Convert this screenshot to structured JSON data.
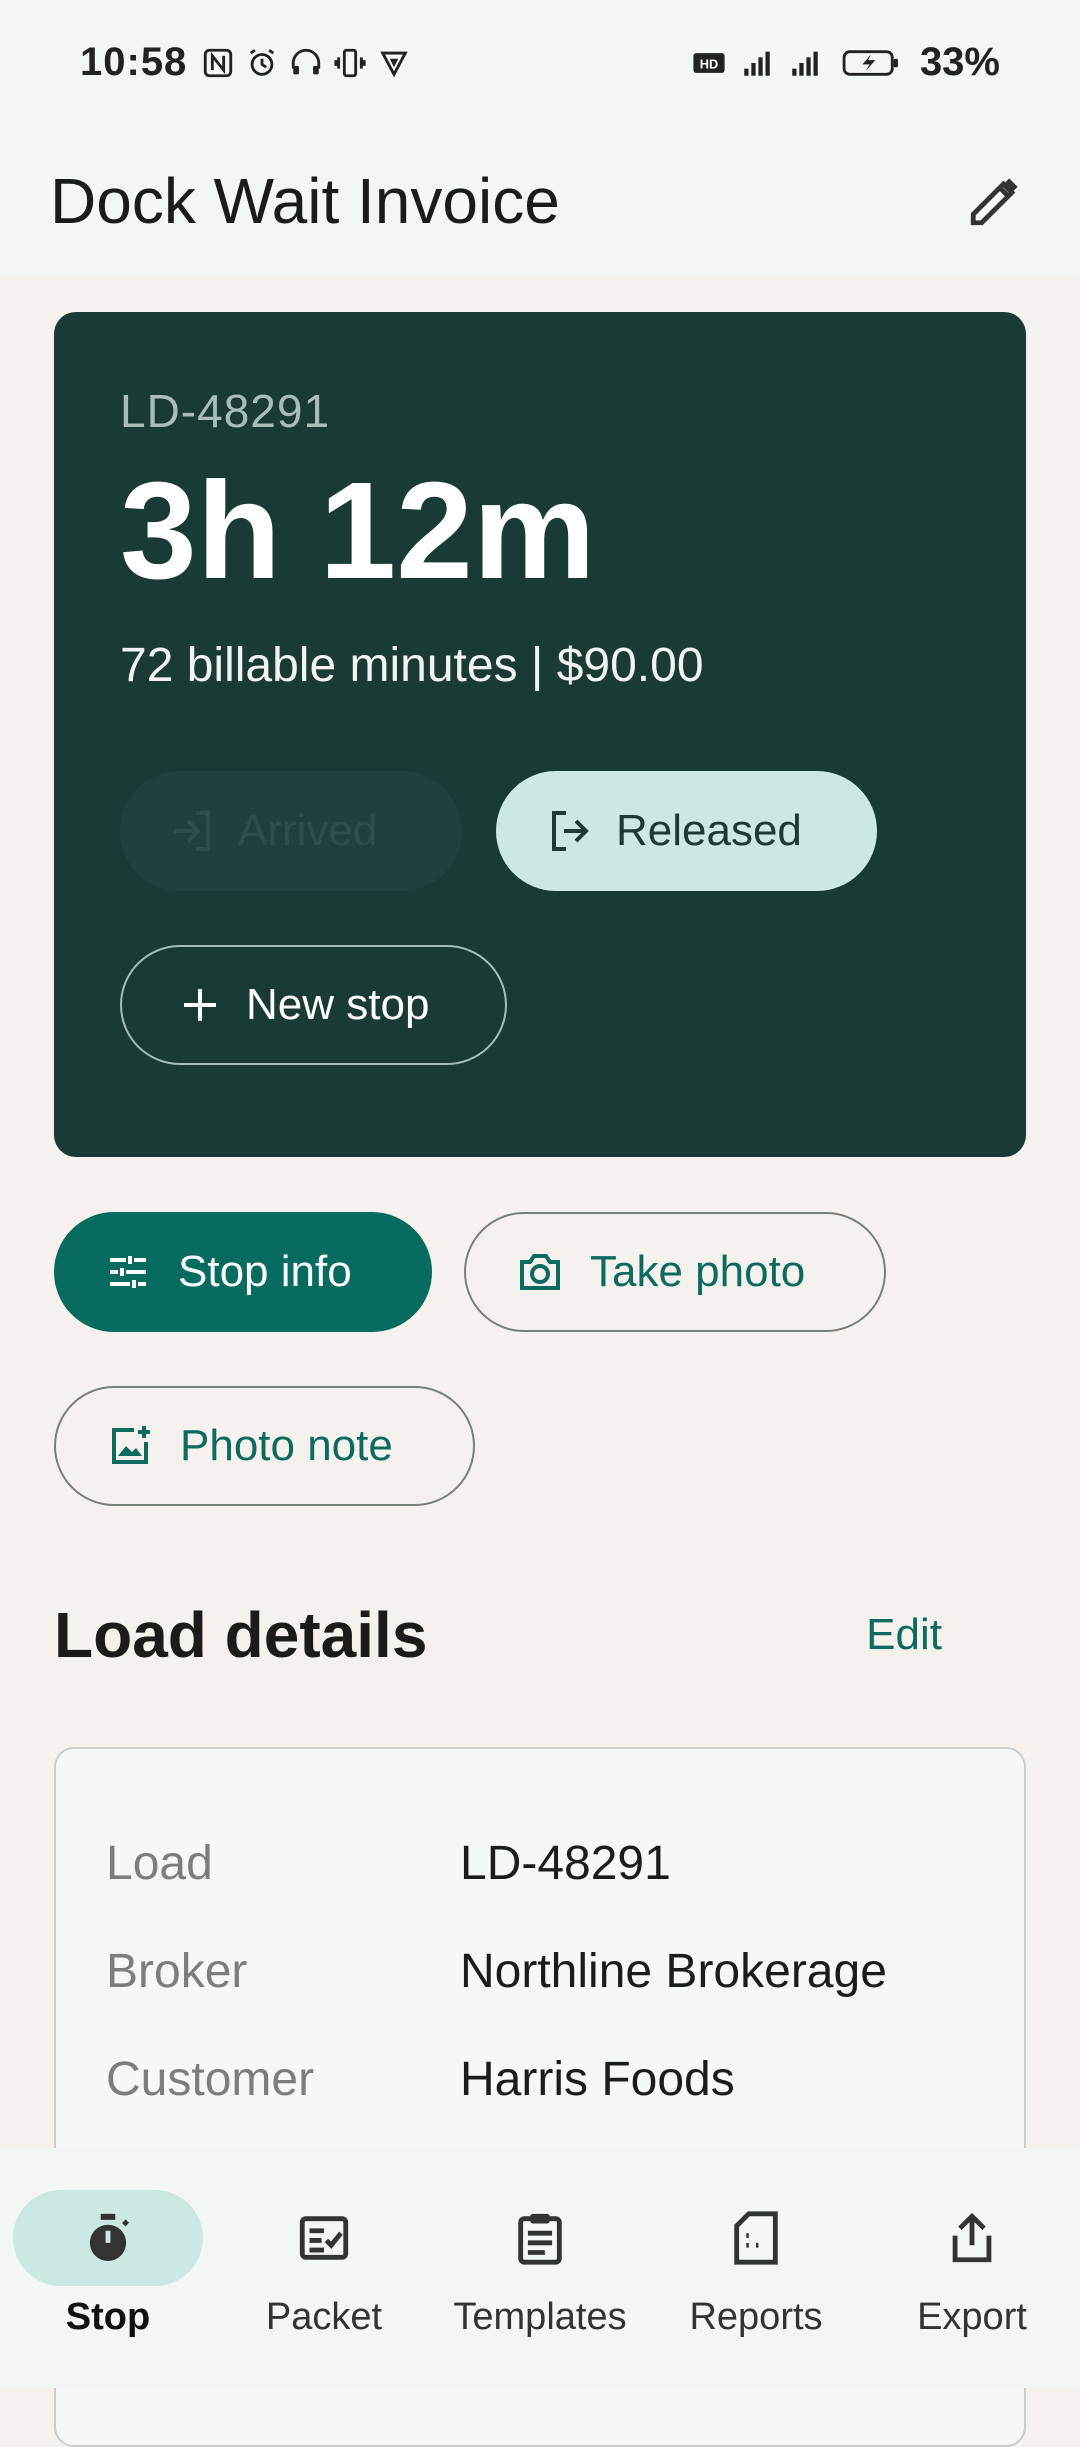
{
  "status_bar": {
    "time": "10:58",
    "battery_percent": "33%",
    "left_icons": [
      "nfc-icon",
      "alarm-icon",
      "headphones-battery-icon",
      "vibrate-icon",
      "vpn-icon"
    ],
    "right_icons": [
      "hd-icon",
      "5g-signal-icon",
      "signal-icon",
      "battery-charging-icon"
    ]
  },
  "appbar": {
    "title": "Dock Wait Invoice",
    "edit_icon": "pencil-icon"
  },
  "hero": {
    "load_id": "LD-48291",
    "timer": "3h 12m",
    "summary": "72 billable minutes | $90.00",
    "arrived_label": "Arrived",
    "released_label": "Released",
    "new_stop_label": "New stop"
  },
  "actions": {
    "stop_info_label": "Stop info",
    "take_photo_label": "Take photo",
    "photo_note_label": "Photo note"
  },
  "load_details": {
    "heading": "Load details",
    "edit_label": "Edit",
    "rows": [
      {
        "key": "Load",
        "value": "LD-48291"
      },
      {
        "key": "Broker",
        "value": "Northline Brokerage"
      },
      {
        "key": "Customer",
        "value": "Harris Foods"
      }
    ]
  },
  "bottom_nav": {
    "items": [
      {
        "label": "Stop",
        "icon": "timer-icon",
        "active": true
      },
      {
        "label": "Packet",
        "icon": "checklist-icon",
        "active": false
      },
      {
        "label": "Templates",
        "icon": "clipboard-icon",
        "active": false
      },
      {
        "label": "Reports",
        "icon": "report-icon",
        "active": false
      },
      {
        "label": "Export",
        "icon": "share-icon",
        "active": false
      }
    ]
  },
  "colors": {
    "hero_bg": "#1a3a36",
    "primary": "#086b5f",
    "accent_light": "#cbe8e2",
    "page_bg": "#f5f2ee"
  }
}
